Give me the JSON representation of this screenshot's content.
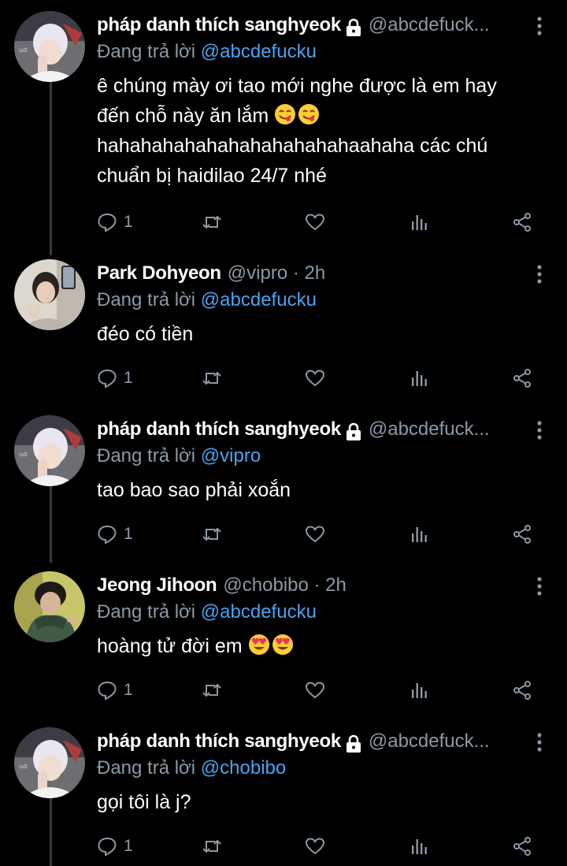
{
  "tweets": [
    {
      "author": "pháp danh thích sanghyeok",
      "locked": true,
      "handle": "@abcdefuck...",
      "reply_prefix": "Đang trả lời ",
      "reply_to": "@abcdefucku",
      "lines": [
        "ê chúng mày ơi tao mới nghe được là em hay",
        "đến chỗ này ăn lắm",
        "hahahahahahahahahahahahaahaha các chú",
        "chuẩn bị haidilao 24/7 nhé"
      ],
      "reply_count": "1",
      "avatar": "avatar-white-hair"
    },
    {
      "author": "Park Dohyeon",
      "handle": "@vipro · 2h",
      "reply_prefix": "Đang trả lời ",
      "reply_to": "@abcdefucku",
      "lines": [
        "đéo có tiền"
      ],
      "reply_count": "1",
      "avatar": "avatar-selfie"
    },
    {
      "author": "pháp danh thích sanghyeok",
      "locked": true,
      "handle": "@abcdefuck...",
      "reply_prefix": "Đang trả lời ",
      "reply_to": "@vipro",
      "lines": [
        "tao bao sao phải xoắn"
      ],
      "reply_count": "1",
      "avatar": "avatar-white-hair"
    },
    {
      "author": "Jeong Jihoon",
      "handle": "@chobibo · 2h",
      "reply_prefix": "Đang trả lời ",
      "reply_to": "@abcdefucku",
      "lines": [
        "hoàng tử đời em"
      ],
      "reply_count": "1",
      "avatar": "avatar-green-scarf"
    },
    {
      "author": "pháp danh thích sanghyeok",
      "locked": true,
      "handle": "@abcdefuck...",
      "reply_prefix": "Đang trả lời ",
      "reply_to": "@chobibo",
      "lines": [
        "gọi tôi là j?"
      ],
      "reply_count": "1",
      "avatar": "avatar-white-hair"
    }
  ],
  "icons": {
    "reply": "reply-icon",
    "retweet": "retweet-icon",
    "like": "heart-icon",
    "views": "analytics-icon",
    "share": "share-icon",
    "more": "more-vertical-icon",
    "lock": "lock-icon",
    "emoji_yum": "face-savoring-food-emoji",
    "emoji_heart_eyes": "heart-eyes-emoji"
  },
  "colors": {
    "background": "#000000",
    "text": "#ffffff",
    "secondary": "#8b98a5",
    "mention": "#4aa3f0"
  }
}
